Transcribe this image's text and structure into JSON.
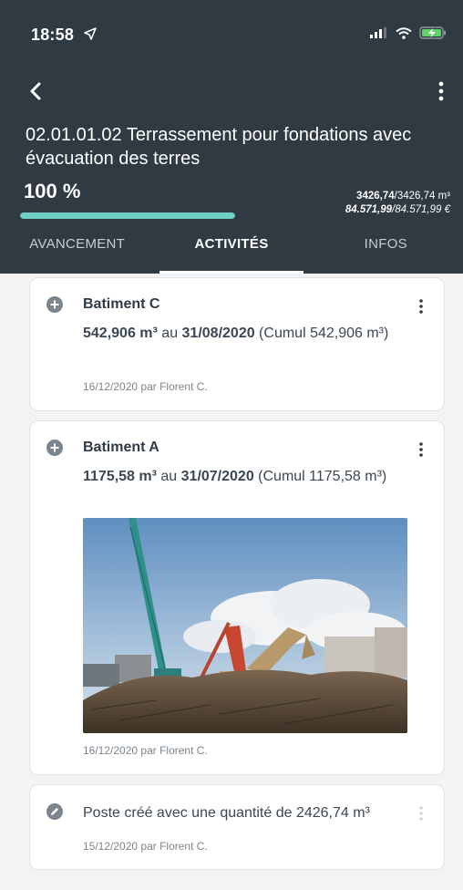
{
  "status": {
    "time": "18:58"
  },
  "header": {
    "title": "02.01.01.02 Terrassement pour fondations avec évacuation des terres",
    "percent_label": "100 %",
    "progress_value": 1.0,
    "qty_done": "3426,74",
    "qty_total": "/3426,74 m³",
    "money_done": "84.571,99",
    "money_total": "/84.571,99 €",
    "accent_color": "#6fcfc3"
  },
  "tabs": [
    {
      "label": "AVANCEMENT"
    },
    {
      "label": "ACTIVITÉS",
      "active": true
    },
    {
      "label": "INFOS"
    }
  ],
  "activities": [
    {
      "title": "Batiment C",
      "qty_bold": "542,906 m³",
      "qty_mid": " au ",
      "date_bold": "31/08/2020",
      "qty_tail": " (Cumul 542,906 m³)",
      "meta": "16/12/2020 par Florent C."
    },
    {
      "title": "Batiment A",
      "qty_bold": "1175,58 m³",
      "qty_mid": " au ",
      "date_bold": "31/07/2020",
      "qty_tail": " (Cumul 1175,58 m³)",
      "meta": "16/12/2020 par Florent C."
    },
    {
      "text": "Poste créé avec une quantité de 2426,74 m³",
      "meta": "15/12/2020 par Florent C."
    }
  ]
}
